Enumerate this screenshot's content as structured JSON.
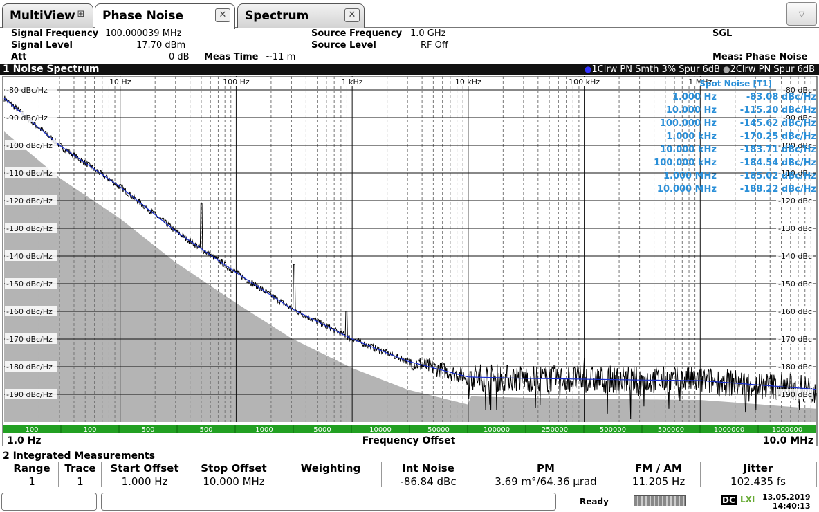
{
  "tabs": [
    {
      "label": "MultiView",
      "icon": "multiview-grid-icon"
    },
    {
      "label": "Phase Noise",
      "icon": "close-icon"
    },
    {
      "label": "Spectrum",
      "icon": "close-icon"
    }
  ],
  "menu_icon": "chevron-down-icon",
  "info": {
    "signal_frequency_label": "Signal Frequency",
    "signal_frequency_value": "100.000039 MHz",
    "signal_level_label": "Signal Level",
    "signal_level_value": "17.70 dBm",
    "att_label": "Att",
    "att_value": "0 dB",
    "meas_time_label": "Meas Time",
    "meas_time_value": "~11 m",
    "source_frequency_label": "Source Frequency",
    "source_frequency_value": "1.0 GHz",
    "source_level_label": "Source Level",
    "source_level_value": "RF Off",
    "mode": "SGL",
    "meas": "Meas: Phase Noise"
  },
  "window1": {
    "title": "1 Noise Spectrum",
    "trace1_label": "1Clrw PN Smth 3% Spur 6dB",
    "trace2_label": "2Clrw PN Spur 6dB"
  },
  "chart_data": {
    "type": "line",
    "title": "1 Noise Spectrum",
    "xlabel": "Frequency Offset",
    "xscale": "log",
    "xlim": [
      "1.0 Hz",
      "10.0 MHz"
    ],
    "ylim": [
      -200,
      -75
    ],
    "y_ticks_left": [
      "-80 dBc/Hz",
      "-90 dBc/Hz",
      "-100 dBc/Hz",
      "-110 dBc/Hz",
      "-120 dBc/Hz",
      "-130 dBc/Hz",
      "-140 dBc/Hz",
      "-150 dBc/Hz",
      "-160 dBc/Hz",
      "-170 dBc/Hz",
      "-180 dBc/Hz",
      "-190 dBc/Hz"
    ],
    "y_ticks_right": [
      "-80 dBc",
      "-90 dBc",
      "-100 dBc",
      "-110 dBc",
      "-120 dBc",
      "-130 dBc",
      "-140 dBc",
      "-150 dBc",
      "-160 dBc",
      "-170 dBc",
      "-180 dBc",
      "-190 dBc"
    ],
    "x_ticks": [
      "10 Hz",
      "100 Hz",
      "1 kHz",
      "10 kHz",
      "100 kHz",
      "1 MHz"
    ],
    "x_start_label": "1.0 Hz",
    "x_stop_label": "10.0 MHz",
    "rbw_bar": [
      "100",
      "100",
      "500",
      "500",
      "1000",
      "5000",
      "10000",
      "50000",
      "100000",
      "250000",
      "500000",
      "500000",
      "1000000",
      "1000000"
    ],
    "spot_noise_title": "Spot Noise [T1]",
    "spot_noise": [
      {
        "offset": "1.000 Hz",
        "value": "-83.08 dBc/Hz"
      },
      {
        "offset": "10.000 Hz",
        "value": "-115.20 dBc/Hz"
      },
      {
        "offset": "100.000 Hz",
        "value": "-145.62 dBc/Hz"
      },
      {
        "offset": "1.000 kHz",
        "value": "-170.25 dBc/Hz"
      },
      {
        "offset": "10.000 kHz",
        "value": "-183.71 dBc/Hz"
      },
      {
        "offset": "100.000 kHz",
        "value": "-184.54 dBc/Hz"
      },
      {
        "offset": "1.000 MHz",
        "value": "-185.02 dBc/Hz"
      },
      {
        "offset": "10.000 MHz",
        "value": "-188.22 dBc/Hz"
      }
    ],
    "smooth_trace": {
      "name": "1Clrw PN Smth 3% Spur 6dB",
      "x_hz": [
        1,
        3,
        10,
        30,
        100,
        300,
        1000,
        3000,
        10000,
        30000,
        100000,
        300000,
        1000000,
        3000000,
        10000000
      ],
      "y": [
        -83,
        -100,
        -115,
        -131,
        -146,
        -159,
        -170,
        -178,
        -183.7,
        -184.2,
        -184.5,
        -184.8,
        -185,
        -186.5,
        -188.2
      ]
    },
    "colors": {
      "smooth_trace": "#1a2fd0",
      "raw_trace": "#000000",
      "noise_floor": "#b4b4b4",
      "spot_noise_text": "#2a8fd8",
      "rbw_bar": "#22a022"
    }
  },
  "window2": {
    "title": "2 Integrated Measurements"
  },
  "table": {
    "headers": [
      "Range",
      "Trace",
      "Start Offset",
      "Stop Offset",
      "Weighting",
      "Int Noise",
      "PM",
      "FM / AM",
      "Jitter"
    ],
    "row": [
      "1",
      "1",
      "1.000 Hz",
      "10.000 MHz",
      "",
      "-86.84 dBc",
      "3.69 m°/64.36 µrad",
      "11.205 Hz",
      "102.435 fs"
    ]
  },
  "status": {
    "ready": "Ready",
    "dc": "DC",
    "lxi": "LXI",
    "date": "13.05.2019",
    "time": "14:40:13"
  }
}
